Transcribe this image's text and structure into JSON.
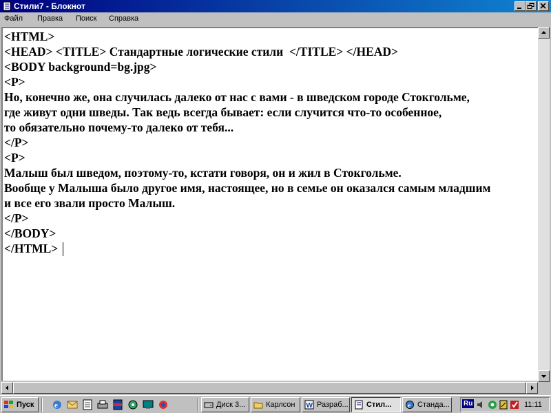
{
  "window": {
    "title": "Стили7 - Блокнот",
    "buttons": [
      "minimize",
      "maximize",
      "close"
    ]
  },
  "menu": [
    {
      "label": "Файл"
    },
    {
      "label": "Правка"
    },
    {
      "label": "Поиск"
    },
    {
      "label": "Справка"
    }
  ],
  "document": {
    "lines": [
      "<HTML>",
      "<HEAD> <TITLE> Стандартные логические стили  </TITLE> </HEAD>",
      "<BODY background=bg.jpg>",
      "<P>",
      "Но, конечно же, она случилась далеко от нас с вами - в шведском городе Стокгольме,",
      "где живут одни шведы. Так ведь всегда бывает: если случится что-то особенное,",
      "то обязательно почему-то далеко от тебя...",
      "</P>",
      "<P>",
      "Малыш был шведом, поэтому-то, кстати говоря, он и жил в Стокгольме.",
      "Вообще у Малыша было другое имя, настоящее, но в семье он оказался самым младшим",
      "и все его звали просто Малыш.",
      "</P>",
      "</BODY>",
      "</HTML>"
    ]
  },
  "taskbar": {
    "start_label": "Пуск",
    "quick_launch": [
      "internet-explorer-icon",
      "outlook-express-icon",
      "notepad-icon",
      "printer-icon",
      "winrar-icon",
      "media-icon",
      "desktop-icon",
      "channels-icon"
    ],
    "tasks": [
      {
        "label": "Диск 3...",
        "icon": "drive-icon",
        "active": false
      },
      {
        "label": "Карлсон",
        "icon": "folder-icon",
        "active": false
      },
      {
        "label": "Разраб...",
        "icon": "word-icon",
        "active": false
      },
      {
        "label": "Стил...",
        "icon": "notepad-icon",
        "active": true
      },
      {
        "label": "Станда...",
        "icon": "browser-icon",
        "active": false
      }
    ],
    "tray": {
      "language": "Ru",
      "clock": "11:11"
    }
  },
  "colors": {
    "title_start": "#000080",
    "title_end": "#1084d0",
    "face": "#c0c0c0",
    "editor_bg": "#ffffff"
  }
}
